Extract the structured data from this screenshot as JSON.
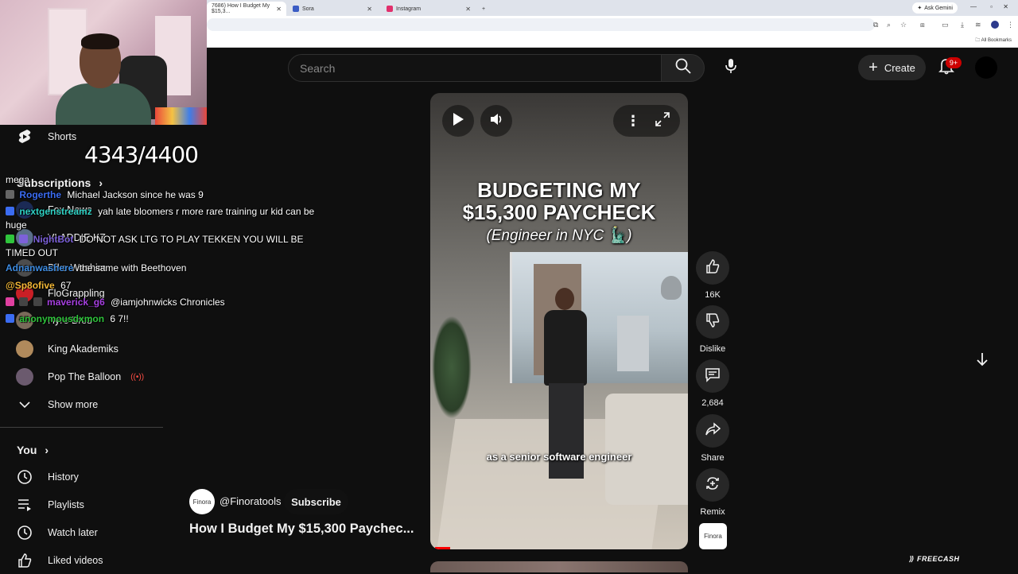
{
  "browser": {
    "tabs": [
      {
        "label": "7686) How I Budget My $15,3...",
        "active": true
      },
      {
        "label": "Sora",
        "active": false
      },
      {
        "label": "Instagram",
        "active": false
      }
    ],
    "ask_gemini": "Ask Gemini",
    "all_bookmarks": "All Bookmarks"
  },
  "counter": "4343/4400",
  "sidebar": {
    "shorts": "Shorts",
    "subscriptions_heading": "Subscriptions",
    "subscriptions": [
      {
        "label": "Fox News"
      },
      {
        "label": "VLADDIE KZ"
      },
      {
        "label": "Diko Washim"
      },
      {
        "label": "FloGrappling"
      },
      {
        "label": "Hyre Bros"
      },
      {
        "label": "King Akademiks"
      },
      {
        "label": "Pop The Balloon",
        "live": true
      }
    ],
    "show_more": "Show more",
    "you_heading": "You",
    "you_items": [
      "History",
      "Playlists",
      "Watch later",
      "Liked videos"
    ]
  },
  "chat": [
    {
      "user": "mega",
      "color": "#ffffff",
      "text": ""
    },
    {
      "user": "Rogerthe",
      "color": "#3b6cf2",
      "text": "Michael Jackson since he was 9"
    },
    {
      "user": "nextgenstreamz",
      "color": "#2fd1c4",
      "text": "yah late bloomers r more rare training ur kid can be huge"
    },
    {
      "user": "NightBot",
      "color": "#7c61d9",
      "text": "DO NOT ASK LTG TO PLAY TEKKEN YOU WILL BE TIMED OUT"
    },
    {
      "user": "Adnanwashere",
      "color": "#3d8be0",
      "text": "the same with Beethoven"
    },
    {
      "user": "@Sp8ofive",
      "color": "#f2b736",
      "text": "67"
    },
    {
      "user": "maverick_g6",
      "color": "#a640e0",
      "text": "@iamjohnwicks Chronicles"
    },
    {
      "user": "anonymousdxmon",
      "color": "#2fc43c",
      "text": "6 7!!"
    }
  ],
  "youtube": {
    "search_placeholder": "Search",
    "create_label": "Create",
    "notif_count": "9+"
  },
  "video": {
    "title_line1": "BUDGETING MY",
    "title_line2": "$15,300 PAYCHECK",
    "subtitle": "(Engineer in NYC 🗽)",
    "caption": "as a senior software engineer",
    "progress_fraction": 0.06
  },
  "channel": {
    "avatar_text": "Finora",
    "handle": "@Finoratools",
    "subscribe_label": "Subscribe",
    "video_title": "How I Budget My $15,300 Paychec..."
  },
  "actions": {
    "likes": "16K",
    "dislike": "Dislike",
    "comments": "2,684",
    "share": "Share",
    "remix": "Remix",
    "remix_thumb": "Finora"
  },
  "watermark": "FREECASH",
  "colors": {
    "bg": "#0f0f0f",
    "accent_red": "#cc0000",
    "button_bg": "#272727"
  }
}
